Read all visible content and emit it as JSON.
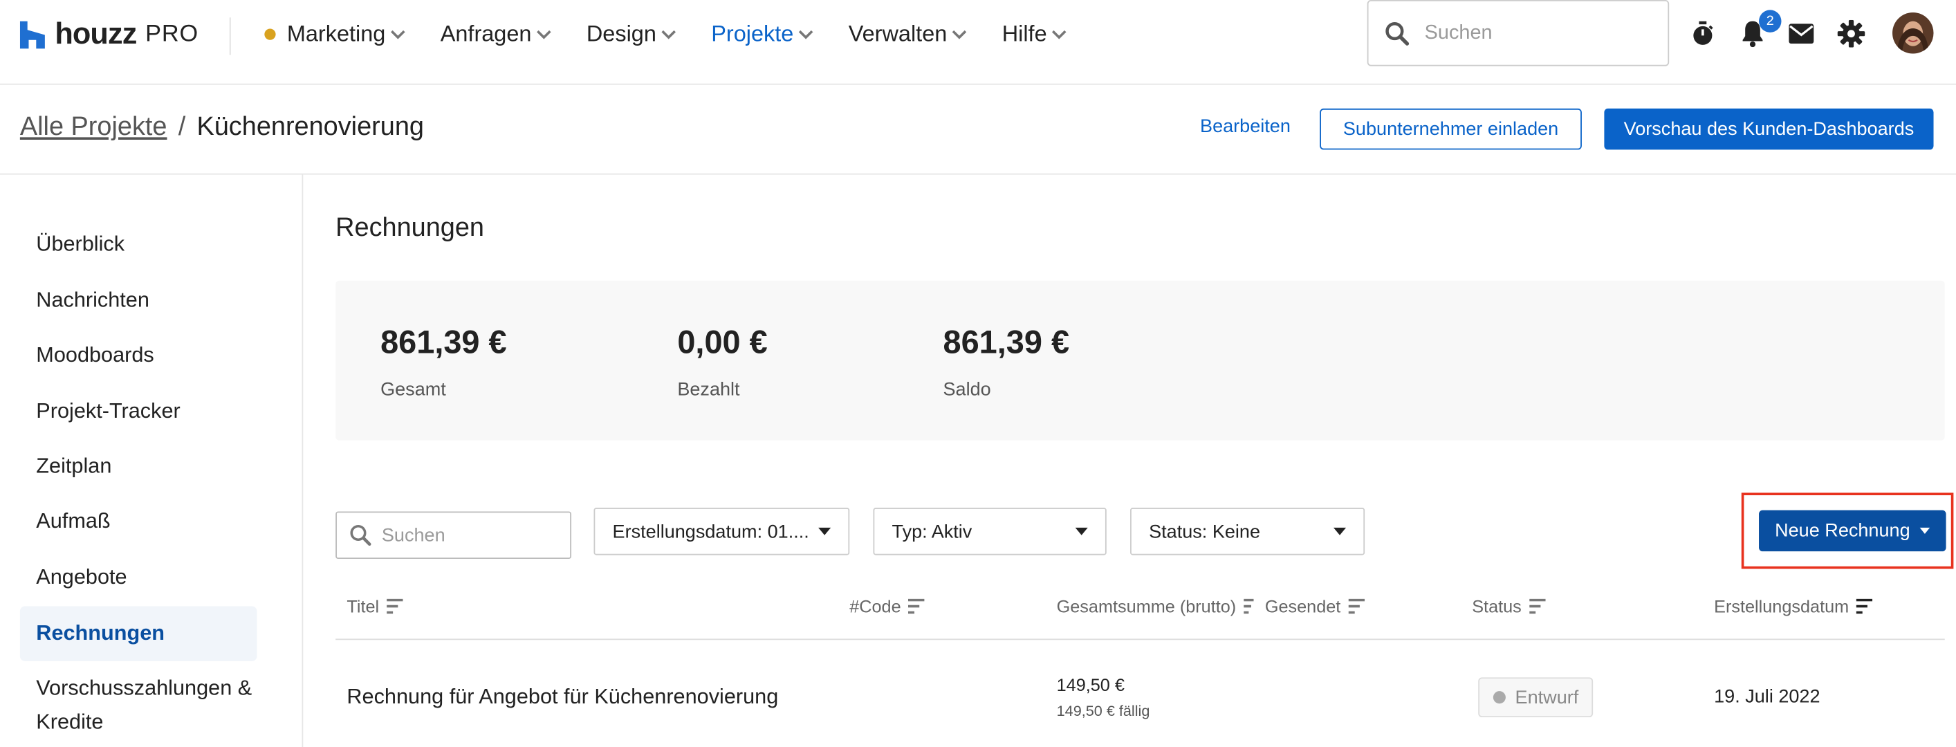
{
  "brand": {
    "name": "houzz",
    "pro": "PRO"
  },
  "nav": {
    "items": [
      {
        "label": "Marketing"
      },
      {
        "label": "Anfragen"
      },
      {
        "label": "Design"
      },
      {
        "label": "Projekte"
      },
      {
        "label": "Verwalten"
      },
      {
        "label": "Hilfe"
      }
    ],
    "search_placeholder": "Suchen",
    "notifications_count": "2"
  },
  "subheader": {
    "breadcrumb_root": "Alle Projekte",
    "breadcrumb_separator": "/",
    "breadcrumb_current": "Küchenrenovierung",
    "edit_label": "Bearbeiten",
    "invite_label": "Subunternehmer einladen",
    "preview_label": "Vorschau des Kunden-Dashboards"
  },
  "sidebar": {
    "items": [
      {
        "label": "Überblick"
      },
      {
        "label": "Nachrichten"
      },
      {
        "label": "Moodboards"
      },
      {
        "label": "Projekt-Tracker"
      },
      {
        "label": "Zeitplan"
      },
      {
        "label": "Aufmaß"
      },
      {
        "label": "Angebote"
      },
      {
        "label": "Rechnungen"
      },
      {
        "label": "Vorschusszahlungen & Kredite"
      }
    ]
  },
  "main": {
    "title": "Rechnungen",
    "summary": [
      {
        "value": "861,39 €",
        "label": "Gesamt"
      },
      {
        "value": "0,00 €",
        "label": "Bezahlt"
      },
      {
        "value": "861,39 €",
        "label": "Saldo"
      }
    ],
    "filters": {
      "search_placeholder": "Suchen",
      "created_date": "Erstellungsdatum: 01....",
      "type": "Typ: Aktiv",
      "status": "Status: Keine"
    },
    "new_invoice_label": "Neue Rechnung",
    "table": {
      "columns": [
        "Titel",
        "#Code",
        "Gesamtsumme (brutto)",
        "Gesendet",
        "Status",
        "Erstellungsdatum"
      ],
      "rows": [
        {
          "title": "Rechnung für Angebot für Küchenrenovierung",
          "code": "",
          "amount": "149,50 €",
          "due": "149,50 € fällig",
          "status": "Entwurf",
          "date": "19. Juli 2022"
        }
      ]
    }
  },
  "colors": {
    "accent": "#0a63c9",
    "primary_dark": "#0a4fa0",
    "highlight": "#e8321e",
    "marketing_dot": "#d9a21f"
  }
}
